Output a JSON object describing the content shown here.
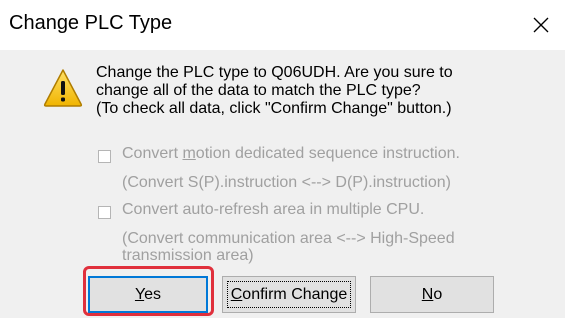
{
  "window": {
    "title": "Change PLC Type"
  },
  "icons": {
    "warning": "warning-icon",
    "close": "close-icon"
  },
  "message": {
    "line1": "Change the PLC type to Q06UDH. Are you sure to",
    "line2": "change all of the data to match the PLC type?",
    "line3": "(To check all data, click \"Confirm Change\" button.)"
  },
  "options": {
    "motion": {
      "pre": "Convert ",
      "mnemonic": "m",
      "post": "otion dedicated sequence instruction.",
      "note": "(Convert S(P).instruction <--> D(P).instruction)",
      "checked": false,
      "enabled": false
    },
    "autorefresh": {
      "label": "Convert auto-refresh area in multiple CPU.",
      "note_line1": "(Convert communication area <--> High-Speed",
      "note_line2": "transmission area)",
      "checked": false,
      "enabled": false
    }
  },
  "buttons": {
    "yes": {
      "mnemonic": "Y",
      "rest": "es"
    },
    "confirm": {
      "mnemonic": "C",
      "rest": "onfirm Change"
    },
    "no": {
      "mnemonic": "N",
      "rest": "o"
    }
  },
  "colors": {
    "highlight": "#e0303c",
    "disabled_text": "#a0a0a0",
    "focus_border": "#0078d7",
    "warning_fill": "#f5c400"
  }
}
